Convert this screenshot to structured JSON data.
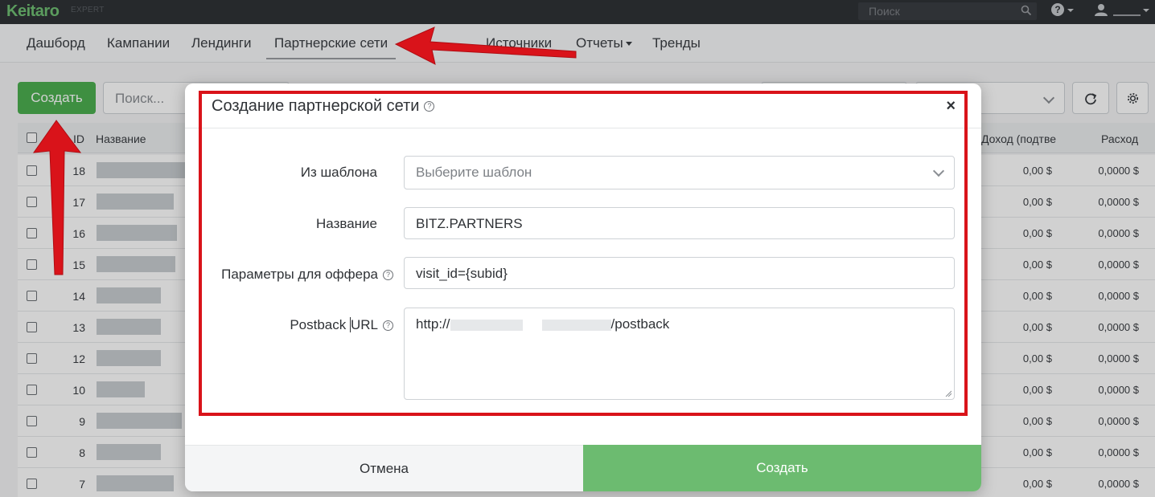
{
  "topbar": {
    "logo": "Keitaro",
    "edition": "EXPERT",
    "search_placeholder": "Поиск",
    "help_label": "?"
  },
  "nav": {
    "items": [
      {
        "label": "Дашборд"
      },
      {
        "label": "Кампании"
      },
      {
        "label": "Лендинги"
      },
      {
        "label": "Партнерские сети"
      },
      {
        "label": "Источники"
      },
      {
        "label": "Отчеты"
      },
      {
        "label": "Тренды"
      }
    ]
  },
  "toolbar": {
    "create_label": "Создать",
    "search_placeholder": "Поиск..."
  },
  "table": {
    "headers": {
      "id": "ID",
      "name": "Название",
      "income": "Доход (подтве",
      "expense": "Расход"
    },
    "rows": [
      {
        "id": "18",
        "v1": "0,00 $",
        "v2": "0,0000 $"
      },
      {
        "id": "17",
        "v1": "0,00 $",
        "v2": "0,0000 $"
      },
      {
        "id": "16",
        "v1": "0,00 $",
        "v2": "0,0000 $"
      },
      {
        "id": "15",
        "v1": "0,00 $",
        "v2": "0,0000 $"
      },
      {
        "id": "14",
        "v1": "0,00 $",
        "v2": "0,0000 $"
      },
      {
        "id": "13",
        "v1": "0,00 $",
        "v2": "0,0000 $"
      },
      {
        "id": "12",
        "v1": "0,00 $",
        "v2": "0,0000 $"
      },
      {
        "id": "10",
        "v1": "0,00 $",
        "v2": "0,0000 $"
      },
      {
        "id": "9",
        "v1": "0,00 $",
        "v2": "0,0000 $"
      },
      {
        "id": "8",
        "v1": "0,00 $",
        "v2": "0,0000 $"
      },
      {
        "id": "7",
        "v1": "0,00 $",
        "v2": "0,0000 $"
      }
    ]
  },
  "modal": {
    "title": "Создание партнерской сети",
    "close": "×",
    "fields": {
      "template_label": "Из шаблона",
      "template_placeholder": "Выберите шаблон",
      "name_label": "Название",
      "name_value": "BITZ.PARTNERS",
      "params_label": "Параметры для оффера",
      "params_value": "visit_id={subid}",
      "postback_label_a": "Postback ",
      "postback_label_b": "URL",
      "postback_prefix": "http://",
      "postback_suffix": "/postback"
    },
    "cancel_label": "Отмена",
    "submit_label": "Создать"
  },
  "colors": {
    "accent_green": "#4caf50",
    "annotation_red": "#d9131a",
    "topbar": "#2f3236"
  }
}
